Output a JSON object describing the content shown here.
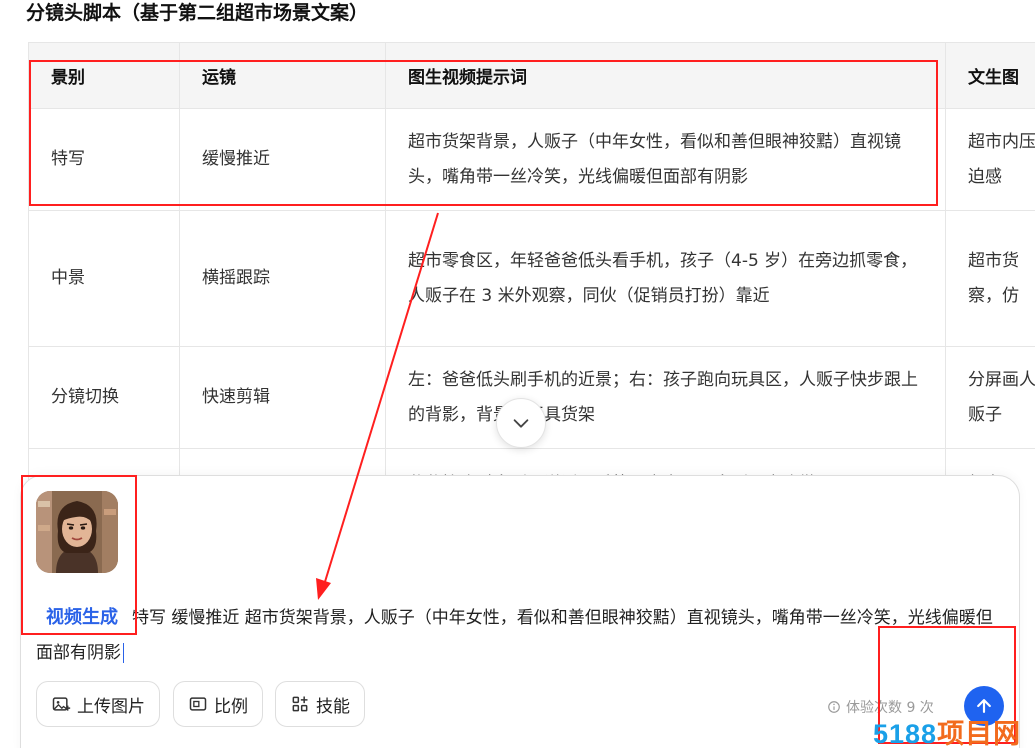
{
  "heading": "分镜头脚本（基于第二组超市场景文案）",
  "table": {
    "headers": [
      "景别",
      "运镜",
      "图生视频提示词",
      "文生图"
    ],
    "rows": [
      [
        "特写",
        "缓慢推近",
        "超市货架背景，人贩子（中年女性，看似和善但眼神狡黠）直视镜头，嘴角带一丝冷笑，光线偏暖但面部有阴影",
        "超市内压迫感"
      ],
      [
        "中景",
        "横摇跟踪",
        "超市零食区，年轻爸爸低头看手机，孩子（4-5 岁）在旁边抓零食，人贩子在 3 米外观察，同伙（促销员打扮）靠近",
        "超市货察，仿"
      ],
      [
        "分镜切换",
        "快速剪辑",
        "左：爸爸低头刷手机的近景；右：孩子跑向玩具区，人贩子快步跟上的背影，背景有玩具货架",
        "分屏画人贩子"
      ],
      [
        "",
        "",
        "爸爸抬头对人贩子说话，手势示意离开，人贩子点头微",
        "超市"
      ]
    ]
  },
  "composer": {
    "skill_tag": "视频生成",
    "prompt_text": "特写  缓慢推近  超市货架背景，人贩子（中年女性，看似和善但眼神狡黠）直视镜头，嘴角带一丝冷笑，光线偏暖但面部有阴影",
    "buttons": {
      "upload": "上传图片",
      "ratio": "比例",
      "skills": "技能"
    },
    "quota": "体验次数 9 次"
  },
  "watermark": {
    "number": "5188",
    "text": "项目网"
  },
  "colors": {
    "accent": "#1f63f0",
    "annotation": "#ff1f1f"
  }
}
